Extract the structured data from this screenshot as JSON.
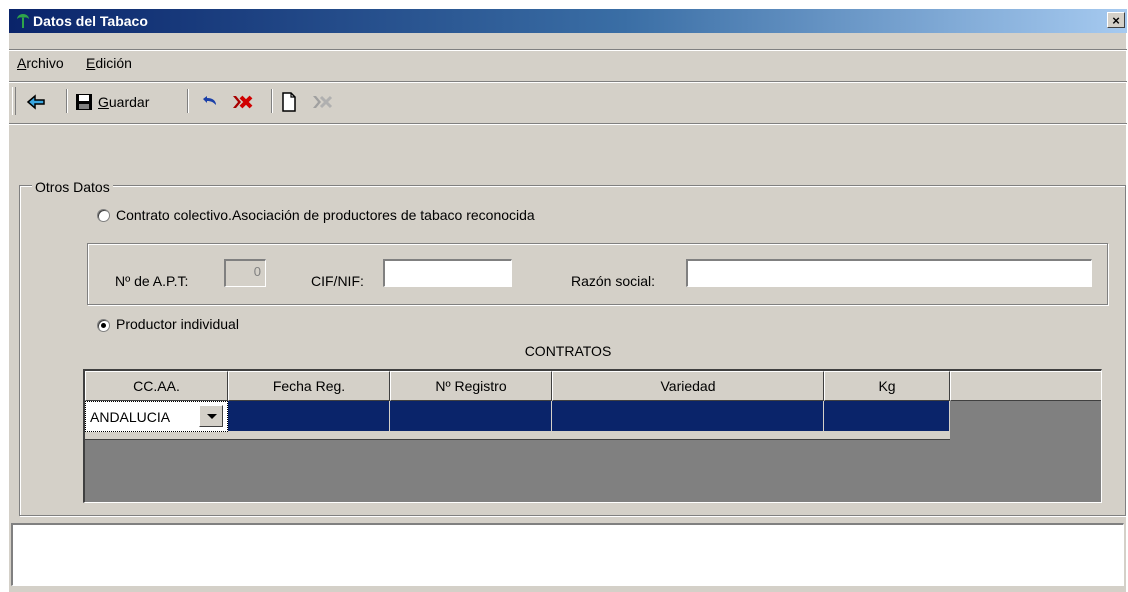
{
  "window": {
    "title": "Datos del Tabaco",
    "close": "×"
  },
  "menu": {
    "archivo": {
      "underline": "A",
      "rest": "rchivo"
    },
    "edicion": {
      "underline": "E",
      "rest": "dición"
    }
  },
  "toolbar": {
    "save": {
      "underline": "G",
      "rest": "uardar"
    }
  },
  "group": {
    "title": "Otros Datos"
  },
  "radio_colectivo": {
    "label": "Contrato colectivo.Asociación de productores de tabaco reconocida",
    "checked": false
  },
  "apt": {
    "label": "Nº de A.P.T:",
    "value": "0"
  },
  "cif": {
    "label": "CIF/NIF:",
    "value": ""
  },
  "razon": {
    "label": "Razón social:",
    "value": ""
  },
  "radio_individual": {
    "label": "Productor individual",
    "checked": true
  },
  "contratos": {
    "title": "CONTRATOS",
    "columns": [
      "CC.AA.",
      "Fecha Reg.",
      "Nº Registro",
      "Variedad",
      "Kg"
    ],
    "row": {
      "ccaa": "ANDALUCIA",
      "fecha": "",
      "registro": "",
      "variedad": "",
      "kg": ""
    }
  }
}
